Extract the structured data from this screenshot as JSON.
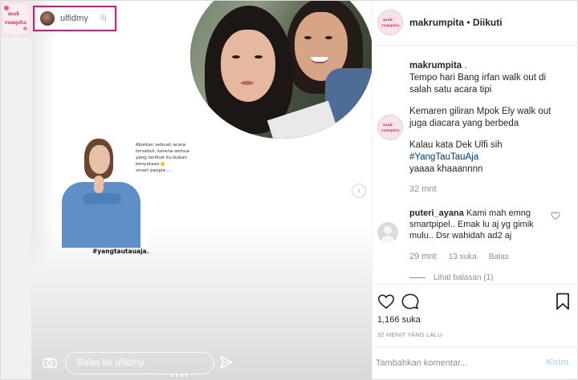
{
  "brand": {
    "logo_line1": "mak",
    "logo_line2": "rumpita"
  },
  "story": {
    "username": "ulfidmy",
    "timestamp_glyph": "8j",
    "quote_lines": [
      "Abaikan sebuah acara",
      "tersebut, karena semua",
      "yang terlihat itu bukan",
      "kenyataan",
      "smart people....."
    ],
    "hashtag": "#yangtautauaja.",
    "reply_placeholder": "Balas ke ulfidmy",
    "next_glyph": "›"
  },
  "post": {
    "author": "makrumpita",
    "separator": " • ",
    "follow_status": "Diikuti",
    "caption_user": "makrumpita",
    "caption_suffix": " .",
    "caption_p1": "Tempo hari Bang irfan walk out di salah satu acara tipi",
    "caption_p2": "Kemaren giliran Mpok Ely walk out juga diacara yang berbeda",
    "caption_p3_a": "Kalau kata Dek Ulfi sih",
    "caption_tag": "#YangTauTauAja",
    "caption_p3_b": "yaaaa khaaannnn",
    "caption_time": "32 mnt",
    "comment": {
      "user": "puteri_ayana",
      "text": " Kami mah emng smartpipel.. Emak lu aj yg gimik mulu.. Dsr wahidah ad2 aj",
      "time": "29 mnt",
      "likes": "13 suka",
      "reply_label": "Balas",
      "view_replies": "Lihat balasan (1)"
    },
    "likes": "1,166 suka",
    "time_ago": "32 MENIT YANG LALU",
    "comment_placeholder": "Tambahkan komentar...",
    "post_label": "Kirim"
  }
}
